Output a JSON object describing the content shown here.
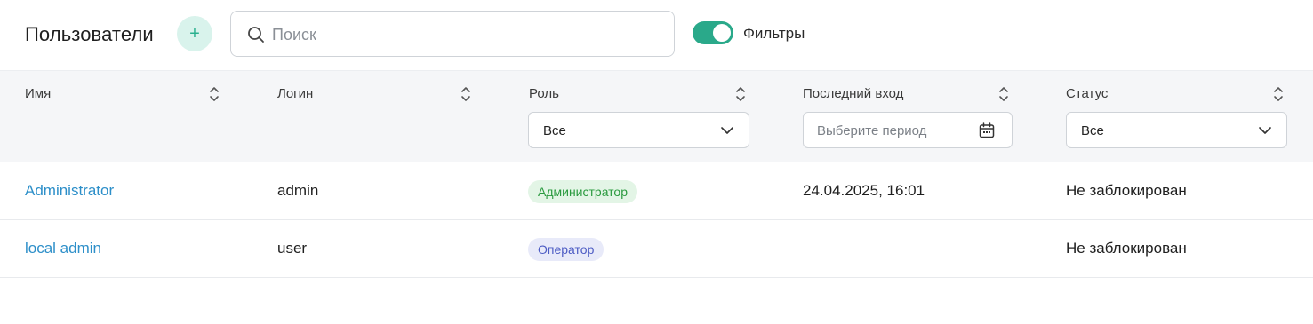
{
  "header": {
    "title": "Пользователи",
    "add_button": "+",
    "search_placeholder": "Поиск",
    "filters_label": "Фильтры",
    "filters_enabled": true
  },
  "columns": [
    {
      "label": "Имя"
    },
    {
      "label": "Логин"
    },
    {
      "label": "Роль"
    },
    {
      "label": "Последний вход"
    },
    {
      "label": "Статус"
    }
  ],
  "filters": {
    "role": "Все",
    "last_login_placeholder": "Выберите период",
    "status": "Все"
  },
  "rows": [
    {
      "name": "Administrator",
      "login": "admin",
      "role": "Администратор",
      "last_login": "24.04.2025, 16:01",
      "status": "Не заблокирован"
    },
    {
      "name": "local admin",
      "login": "user",
      "role": "Оператор",
      "last_login": "",
      "status": "Не заблокирован"
    }
  ],
  "colors": {
    "accent": "#2aa98a",
    "link": "#2d8fc9",
    "admin_badge_bg": "#e3f5e6",
    "admin_badge_text": "#2a9a3f",
    "operator_badge_bg": "#e8eaf9",
    "operator_badge_text": "#4d5cc4"
  },
  "icons": {
    "search": "search-icon",
    "sort": "sort-icon",
    "dropdown": "chevron-down-icon",
    "calendar": "calendar-icon"
  }
}
